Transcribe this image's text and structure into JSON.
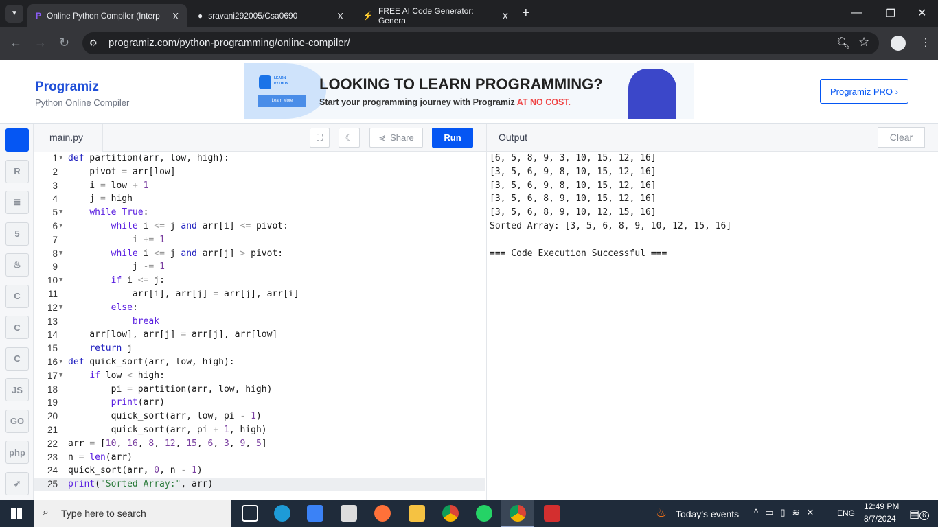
{
  "browser": {
    "tabs": [
      {
        "title": "Online Python Compiler (Interp",
        "active": true
      },
      {
        "title": "sravani292005/Csa0690",
        "active": false
      },
      {
        "title": "FREE AI Code Generator: Genera",
        "active": false
      }
    ],
    "close": "X",
    "new_tab": "+",
    "url": "programiz.com/python-programming/online-compiler/"
  },
  "header": {
    "logo": "Programiz",
    "subtitle": "Python Online Compiler",
    "pro_button": "Programiz PRO ›",
    "ad": {
      "badge_line1": "LEARN",
      "badge_line2": "PYTHON",
      "learn_more": "Learn More",
      "headline": "LOOKING TO LEARN PROGRAMMING?",
      "subline": "Start your programming journey with Programiz ",
      "subline_highlight": "AT NO COST."
    }
  },
  "sidebar": {
    "items": [
      {
        "icon": "python-icon",
        "label": ""
      },
      {
        "icon": "r-icon",
        "label": "R"
      },
      {
        "icon": "sql-icon",
        "label": "≣"
      },
      {
        "icon": "html5-icon",
        "label": "5"
      },
      {
        "icon": "java-icon",
        "label": "♨"
      },
      {
        "icon": "c-icon",
        "label": "C"
      },
      {
        "icon": "cpp-icon",
        "label": "C"
      },
      {
        "icon": "csharp-icon",
        "label": "C"
      },
      {
        "icon": "js-icon",
        "label": "JS"
      },
      {
        "icon": "go-icon",
        "label": "GO"
      },
      {
        "icon": "php-icon",
        "label": "php"
      },
      {
        "icon": "swift-icon",
        "label": "➶"
      }
    ]
  },
  "editor": {
    "file": "main.py",
    "share": "Share",
    "run": "Run",
    "lines": [
      "def partition(arr, low, high):",
      "    pivot = arr[low]",
      "    i = low + 1",
      "    j = high",
      "    while True:",
      "        while i <= j and arr[i] <= pivot:",
      "            i += 1",
      "        while i <= j and arr[j] > pivot:",
      "            j -= 1",
      "        if i <= j:",
      "            arr[i], arr[j] = arr[j], arr[i]",
      "        else:",
      "            break",
      "    arr[low], arr[j] = arr[j], arr[low]",
      "    return j",
      "def quick_sort(arr, low, high):",
      "    if low < high:",
      "        pi = partition(arr, low, high)",
      "        print(arr)",
      "        quick_sort(arr, low, pi - 1)",
      "        quick_sort(arr, pi + 1, high)",
      "arr = [10, 16, 8, 12, 15, 6, 3, 9, 5]",
      "n = len(arr)",
      "quick_sort(arr, 0, n - 1)",
      "print(\"Sorted Array:\", arr)"
    ],
    "fold_lines": [
      1,
      5,
      6,
      8,
      10,
      12,
      16,
      17
    ],
    "active_line": 25
  },
  "output": {
    "title": "Output",
    "clear": "Clear",
    "lines": [
      "[6, 5, 8, 9, 3, 10, 15, 12, 16]",
      "[3, 5, 6, 9, 8, 10, 15, 12, 16]",
      "[3, 5, 6, 9, 8, 10, 15, 12, 16]",
      "[3, 5, 6, 8, 9, 10, 15, 12, 16]",
      "[3, 5, 6, 8, 9, 10, 12, 15, 16]",
      "Sorted Array: [3, 5, 6, 8, 9, 10, 12, 15, 16]",
      "",
      "=== Code Execution Successful ==="
    ]
  },
  "taskbar": {
    "search_placeholder": "Type here to search",
    "weather": "Today's events",
    "lang": "ENG",
    "time": "12:49 PM",
    "date": "8/7/2024",
    "notifications": "6"
  },
  "colors": {
    "brand": "#0556f3",
    "keyword": "#5a1fe0"
  }
}
